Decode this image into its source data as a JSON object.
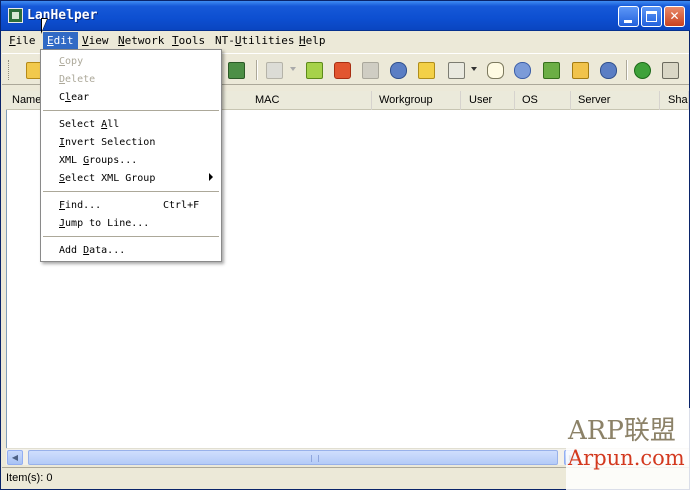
{
  "window": {
    "title": "LanHelper"
  },
  "menubar": {
    "items": [
      {
        "label": "File",
        "key": "F",
        "rest": "ile"
      },
      {
        "label": "Edit",
        "key": "E",
        "rest": "dit"
      },
      {
        "label": "View",
        "key": "V",
        "rest": "iew"
      },
      {
        "label": "Network",
        "key": "N",
        "rest": "etwork"
      },
      {
        "label": "Tools",
        "key": "T",
        "rest": "ools"
      },
      {
        "label": "NT-Utilities",
        "pre": "NT-",
        "key": "U",
        "rest": "tilities"
      },
      {
        "label": "Help",
        "key": "H",
        "rest": "elp"
      }
    ]
  },
  "toolbar": {
    "icons": [
      "open-folder-icon",
      "document-icon",
      "add-computer-icon",
      "refresh-icon",
      "stop-icon",
      "blank-icon",
      "user-search-icon",
      "folder-icon",
      "filter-icon",
      "message-icon",
      "network-icon",
      "share-icon",
      "open-share-icon",
      "user-icon",
      "go-icon",
      "report-icon"
    ]
  },
  "columns": [
    "Name",
    "MAC",
    "Workgroup",
    "User",
    "OS",
    "Server",
    "Sha"
  ],
  "edit_menu": {
    "copy": {
      "key": "C",
      "rest": "opy"
    },
    "delete": {
      "key": "D",
      "rest": "elete"
    },
    "clear": {
      "pre": "C",
      "key": "l",
      "rest": "ear"
    },
    "select_all": {
      "pre": "Select ",
      "key": "A",
      "rest": "ll"
    },
    "invert_selection": {
      "key": "I",
      "rest": "nvert Selection"
    },
    "xml_groups": {
      "pre": "XML ",
      "key": "G",
      "rest": "roups..."
    },
    "select_xml_group": {
      "key": "S",
      "rest": "elect XML Group"
    },
    "find": {
      "key": "F",
      "rest": "ind...",
      "shortcut": "Ctrl+F"
    },
    "jump_to_line": {
      "key": "J",
      "rest": "ump to Line..."
    },
    "add_data": {
      "pre": "Add ",
      "key": "D",
      "rest": "ata..."
    }
  },
  "statusbar": {
    "text": "Item(s): 0"
  },
  "watermark": {
    "line1": "ARP联盟",
    "line2": "Arpun.com"
  }
}
